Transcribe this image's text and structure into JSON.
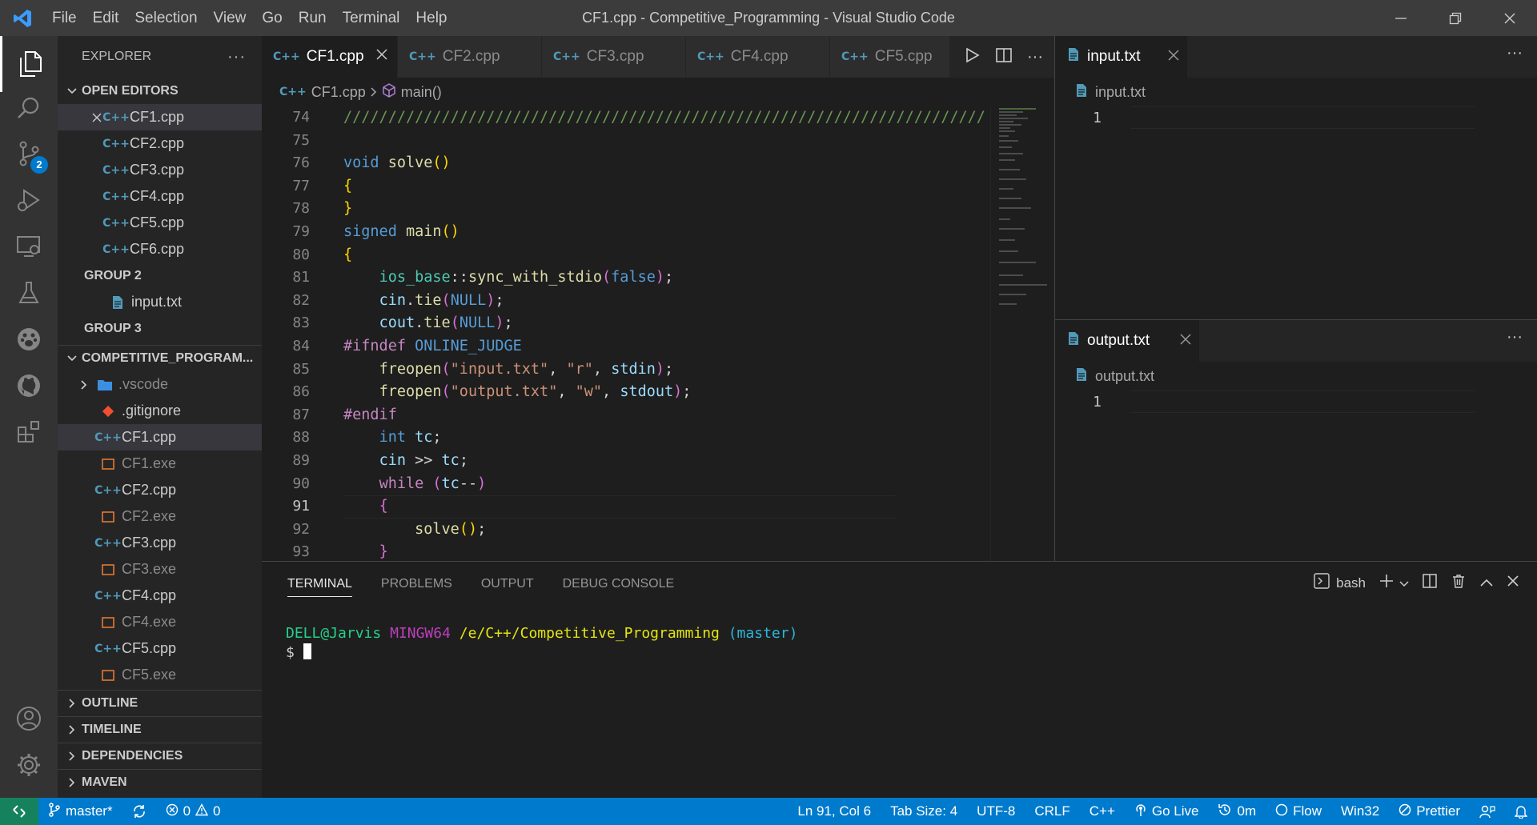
{
  "titlebar": {
    "menu": [
      "File",
      "Edit",
      "Selection",
      "View",
      "Go",
      "Run",
      "Terminal",
      "Help"
    ],
    "title": "CF1.cpp - Competitive_Programming - Visual Studio Code"
  },
  "activity": {
    "scm_badge": "2"
  },
  "sidebar": {
    "header": "EXPLORER",
    "open_editors": {
      "title": "OPEN EDITORS",
      "group1": [
        "CF1.cpp",
        "CF2.cpp",
        "CF3.cpp",
        "CF4.cpp",
        "CF5.cpp",
        "CF6.cpp"
      ],
      "group2_label": "GROUP 2",
      "group2": [
        "input.txt"
      ],
      "group3_label": "GROUP 3"
    },
    "project": {
      "title": "COMPETITIVE_PROGRAM...",
      "items": [
        ".vscode",
        ".gitignore",
        "CF1.cpp",
        "CF1.exe",
        "CF2.cpp",
        "CF2.exe",
        "CF3.cpp",
        "CF3.exe",
        "CF4.cpp",
        "CF4.exe",
        "CF5.cpp",
        "CF5.exe"
      ]
    },
    "sections": [
      "OUTLINE",
      "TIMELINE",
      "DEPENDENCIES",
      "MAVEN"
    ]
  },
  "editor": {
    "tabs": [
      "CF1.cpp",
      "CF2.cpp",
      "CF3.cpp",
      "CF4.cpp",
      "CF5.cpp"
    ],
    "breadcrumb": {
      "file": "CF1.cpp",
      "symbol": "main()"
    },
    "line_numbers": [
      "74",
      "75",
      "76",
      "77",
      "78",
      "79",
      "80",
      "81",
      "82",
      "83",
      "84",
      "85",
      "86",
      "87",
      "88",
      "89",
      "90",
      "91",
      "92",
      "93"
    ],
    "current_line": "91"
  },
  "pane_input": {
    "tab": "input.txt",
    "crumb": "input.txt",
    "line": "1"
  },
  "pane_output": {
    "tab": "output.txt",
    "crumb": "output.txt",
    "line": "1"
  },
  "panel": {
    "tabs": [
      "TERMINAL",
      "PROBLEMS",
      "OUTPUT",
      "DEBUG CONSOLE"
    ],
    "shell": "bash",
    "prompt": {
      "user": "DELL@Jarvis",
      "sys": "MINGW64",
      "path": "/e/C++/Competitive_Programming",
      "branch": "(master)",
      "symbol": "$"
    }
  },
  "status": {
    "branch": "master*",
    "errors": "0",
    "warnings": "0",
    "position": "Ln 91, Col 6",
    "tab_size": "Tab Size: 4",
    "encoding": "UTF-8",
    "eol": "CRLF",
    "language": "C++",
    "golive": "Go Live",
    "time": "0m",
    "flow": "Flow",
    "platform": "Win32",
    "prettier": "Prettier"
  },
  "colors": {
    "accent": "#007acc",
    "remote": "#16825d",
    "titlebar": "#3c3c3c"
  }
}
